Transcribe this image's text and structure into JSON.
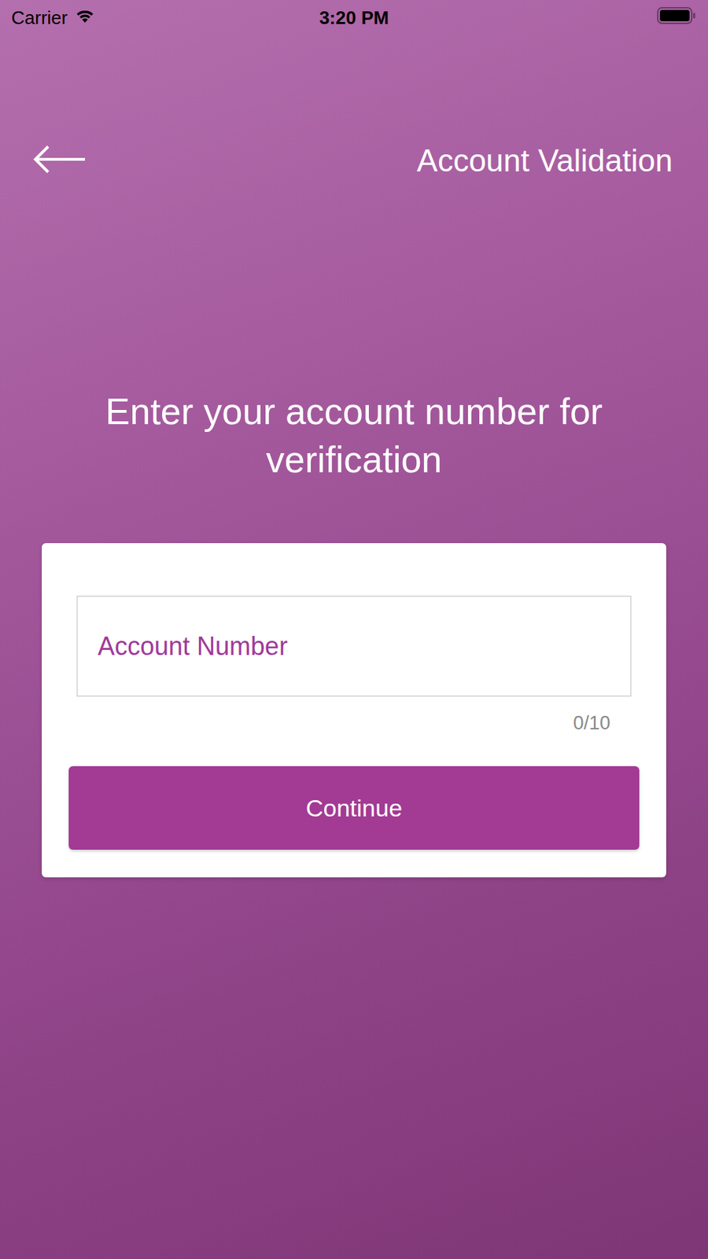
{
  "status_bar": {
    "carrier": "Carrier",
    "time": "3:20 PM"
  },
  "header": {
    "title": "Account Validation"
  },
  "heading": "Enter your account number for verification",
  "form": {
    "field": {
      "placeholder": "Account Number",
      "counter": "0/10"
    },
    "button": "Continue"
  }
}
